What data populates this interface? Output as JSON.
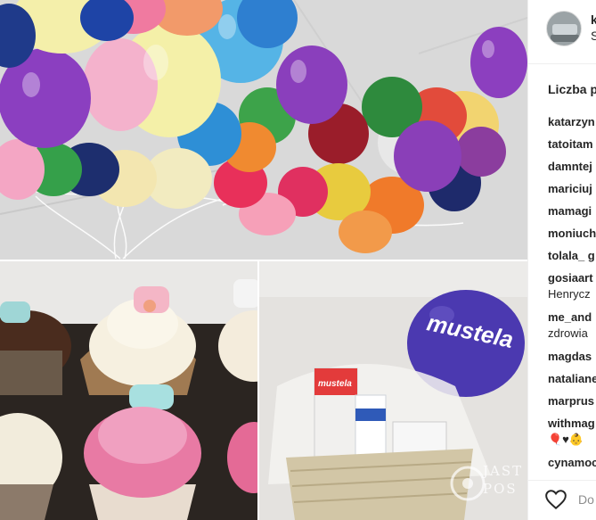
{
  "post": {
    "username": "k",
    "location": "S",
    "likes_title": "Liczba p",
    "likers": [
      {
        "user": "katarzyn"
      },
      {
        "user": "tatoitam"
      },
      {
        "user": "damntej"
      },
      {
        "user": "mariciuj"
      },
      {
        "user": "mamagi"
      },
      {
        "user": "moniuch"
      },
      {
        "user": "tolala_ g"
      },
      {
        "user": "gosiaart",
        "text": "Henrycz"
      },
      {
        "user": "me_and",
        "text": "zdrowia"
      },
      {
        "user": "magdas"
      },
      {
        "user": "nataliane"
      },
      {
        "user": "marprus"
      },
      {
        "user": "withmag",
        "text": "🎈♥👶"
      },
      {
        "user": "cynamoc"
      }
    ],
    "footer_text": "Do"
  },
  "photo": {
    "balloon_brand": "mustela",
    "package_brand": "mustela",
    "watermark": "JAST\nPOS"
  },
  "colors": {
    "link": "#262626",
    "muted": "#8e8e8e",
    "border": "#efefef",
    "mustela_purple": "#4b39b0"
  },
  "icons": [
    "heart-icon"
  ]
}
